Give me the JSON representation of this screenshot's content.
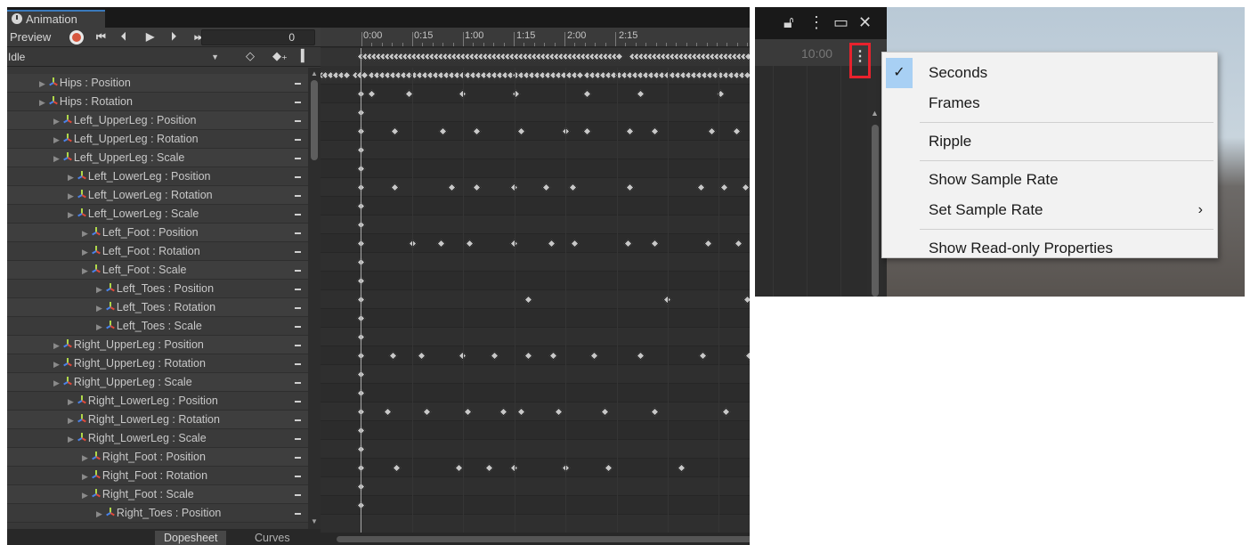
{
  "window": {
    "tab_title": "Animation",
    "preview_label": "Preview",
    "controls": [
      "⏮",
      "⏴",
      "▶",
      "⏵",
      "⏭"
    ],
    "frame_value": "0",
    "clip_name": "Idle",
    "bottom_tabs": [
      "Dopesheet",
      "Curves"
    ]
  },
  "properties": [
    "Hips : Position",
    "Hips : Rotation",
    "Left_UpperLeg : Position",
    "Left_UpperLeg : Rotation",
    "Left_UpperLeg : Scale",
    "Left_LowerLeg : Position",
    "Left_LowerLeg : Rotation",
    "Left_LowerLeg : Scale",
    "Left_Foot : Position",
    "Left_Foot : Rotation",
    "Left_Foot : Scale",
    "Left_Toes : Position",
    "Left_Toes : Rotation",
    "Left_Toes : Scale",
    "Right_UpperLeg : Position",
    "Right_UpperLeg : Rotation",
    "Right_UpperLeg : Scale",
    "Right_LowerLeg : Position",
    "Right_LowerLeg : Rotation",
    "Right_LowerLeg : Scale",
    "Right_Foot : Position",
    "Right_Foot : Rotation",
    "Right_Foot : Scale",
    "Right_Toes : Position"
  ],
  "timeline": {
    "tick_labels": [
      "0:00",
      "0:15",
      "1:00",
      "1:15",
      "2:00",
      "2:15"
    ]
  },
  "menu_header": {
    "ruler_label": "10:00"
  },
  "context_menu": {
    "items": [
      {
        "label": "Seconds",
        "checked": true,
        "submenu": false
      },
      {
        "label": "Frames",
        "checked": false,
        "submenu": false
      },
      {
        "label": "Ripple",
        "checked": false,
        "submenu": false
      },
      {
        "label": "Show Sample Rate",
        "checked": false,
        "submenu": false
      },
      {
        "label": "Set Sample Rate",
        "checked": false,
        "submenu": true
      },
      {
        "label": "Show Read-only Properties",
        "checked": false,
        "submenu": false
      }
    ]
  }
}
